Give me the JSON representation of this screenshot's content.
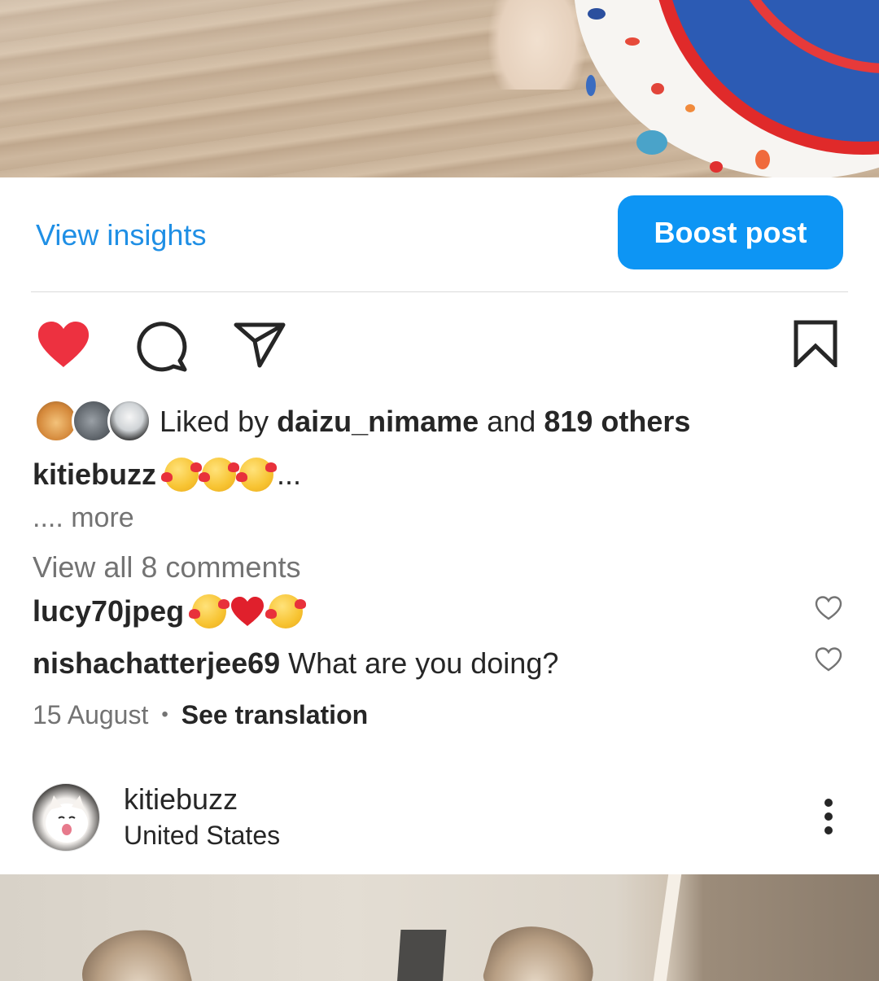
{
  "post": {
    "view_insights_label": "View insights",
    "boost_label": "Boost post",
    "likes": {
      "prefix": "Liked by",
      "user": "daizu_nimame",
      "joiner": "and",
      "others": "819 others"
    },
    "caption": {
      "username": "kitiebuzz",
      "ellipsis": "...",
      "more": ".... more"
    },
    "view_all_comments": "View all 8 comments",
    "comments": [
      {
        "username": "lucy70jpeg",
        "text": ""
      },
      {
        "username": "nishachatterjee69",
        "text": "What are you doing?"
      }
    ],
    "date": "15 August",
    "see_translation": "See translation"
  },
  "next_post": {
    "username": "kitiebuzz",
    "location": "United States"
  },
  "icons": {
    "like": "heart-filled-icon",
    "comment": "comment-icon",
    "share": "share-icon",
    "save": "bookmark-icon",
    "options": "more-vertical-icon"
  },
  "colors": {
    "accent_blue": "#0d95f4",
    "link_blue": "#1f8fe5",
    "like_red": "#ed3140",
    "secondary_text": "#737373"
  }
}
